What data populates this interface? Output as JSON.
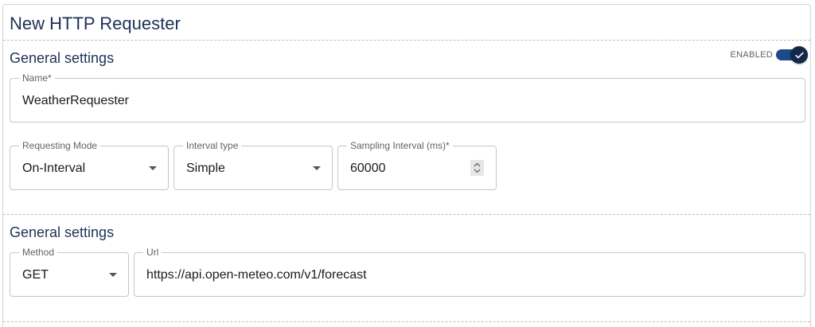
{
  "page": {
    "title": "New HTTP Requester"
  },
  "general": {
    "title": "General settings",
    "enabled_label": "ENABLED",
    "enabled": true,
    "name": {
      "label": "Name*",
      "value": "WeatherRequester"
    },
    "requesting_mode": {
      "label": "Requesting Mode",
      "value": "On-Interval"
    },
    "interval_type": {
      "label": "Interval type",
      "value": "Simple"
    },
    "sampling_interval": {
      "label": "Sampling Interval (ms)*",
      "value": "60000"
    }
  },
  "request": {
    "title": "General settings",
    "method": {
      "label": "Method",
      "value": "GET"
    },
    "url": {
      "label": "Url",
      "value": "https://api.open-meteo.com/v1/forecast"
    }
  },
  "icons": {
    "toggle": "check-icon",
    "select": "chevron-down-icon",
    "stepper": "up-down-arrows-icon"
  },
  "colors": {
    "accent": "#1e4a8a",
    "heading": "#1f3156",
    "border": "#c6c6c6"
  }
}
